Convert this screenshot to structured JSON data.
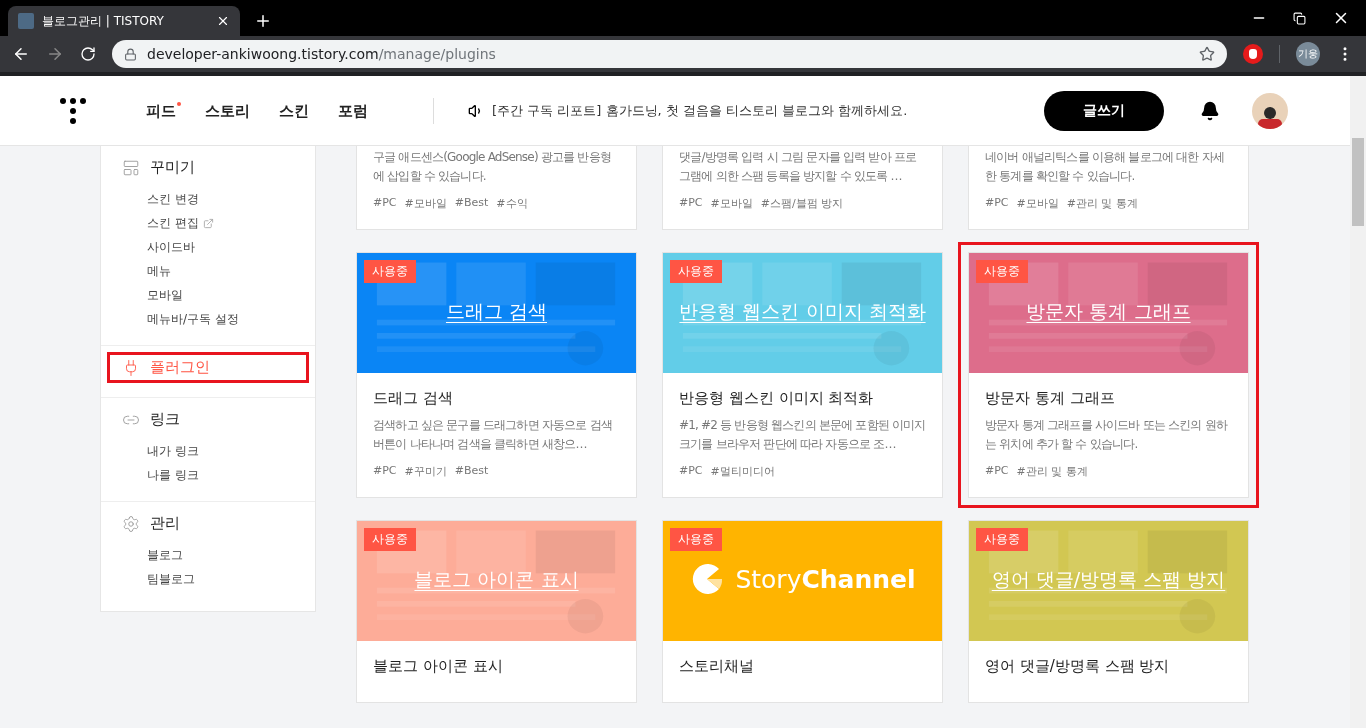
{
  "browser": {
    "tab": {
      "title": "블로그관리 | TISTORY"
    },
    "address": {
      "host": "developer-ankiwoong.tistory.com",
      "path": "/manage/plugins"
    },
    "profile": "기웅"
  },
  "header": {
    "nav": [
      {
        "label": "피드",
        "new": true
      },
      {
        "label": "스토리",
        "new": false
      },
      {
        "label": "스킨",
        "new": false
      },
      {
        "label": "포럼",
        "new": false
      }
    ],
    "notice": "[주간 구독 리포트] 홈가드닝, 첫 걸음을 티스토리 블로그와 함께하세요.",
    "write_button": "글쓰기"
  },
  "sidebar": [
    {
      "label": "꾸미기",
      "selected": false,
      "highlighted": false,
      "items": [
        {
          "label": "스킨 변경",
          "external": false
        },
        {
          "label": "스킨 편집",
          "external": true
        },
        {
          "label": "사이드바",
          "external": false
        },
        {
          "label": "메뉴",
          "external": false
        },
        {
          "label": "모바일",
          "external": false
        },
        {
          "label": "메뉴바/구독 설정",
          "external": false
        }
      ]
    },
    {
      "label": "플러그인",
      "selected": true,
      "highlighted": true
    },
    {
      "label": "링크",
      "selected": false,
      "highlighted": false,
      "items": [
        {
          "label": "내가 링크",
          "external": false
        },
        {
          "label": "나를 링크",
          "external": false
        }
      ]
    },
    {
      "label": "관리",
      "selected": false,
      "highlighted": false,
      "items": [
        {
          "label": "블로그",
          "external": false
        },
        {
          "label": "팀블로그",
          "external": false
        }
      ]
    }
  ],
  "plugins": [
    {
      "description": "구글 애드센스(Google AdSense) 광고를 반응형에 삽입할 수 있습니다.",
      "tags": [
        "#PC",
        "#모바일",
        "#Best",
        "#수익"
      ],
      "highlighted": false
    },
    {
      "description": "댓글/방명록 입력 시 그림 문자를 입력 받아 프로그램에 의한 스팸 등록을 방지할 수 있도록 …",
      "tags": [
        "#PC",
        "#모바일",
        "#스팸/블펌 방지"
      ],
      "highlighted": false
    },
    {
      "description": "네이버 애널리틱스를 이용해 블로그에 대한 자세한 통계를 확인할 수 있습니다.",
      "tags": [
        "#PC",
        "#모바일",
        "#관리 및 통계"
      ],
      "highlighted": false
    },
    {
      "image": {
        "kind": "picture",
        "color": "#0a85f5",
        "title": "드래그 검색"
      },
      "badge": "사용중",
      "title": "드래그 검색",
      "description": "검색하고 싶은 문구를 드래그하면 자동으로 검색 버튼이 나타나며 검색을 클릭하면 새창으…",
      "tags": [
        "#PC",
        "#꾸미기",
        "#Best"
      ],
      "highlighted": false
    },
    {
      "image": {
        "kind": "picture",
        "color": "#62cde8",
        "title": "반응형 웹스킨 이미지 최적화"
      },
      "badge": "사용중",
      "title": "반응형 웹스킨 이미지 최적화",
      "description": "#1, #2 등 반응형 웹스킨의 본문에 포함된 이미지 크기를 브라우저 판단에 따라 자동으로 조…",
      "tags": [
        "#PC",
        "#멀티미디어"
      ],
      "highlighted": false
    },
    {
      "image": {
        "kind": "picture",
        "color": "#dd6d8b",
        "title": "방문자 통계 그래프"
      },
      "badge": "사용중",
      "title": "방문자 통계 그래프",
      "description": "방문자 통계 그래프를 사이드바 또는 스킨의 원하는 위치에 추가 할 수 있습니다.",
      "tags": [
        "#PC",
        "#관리 및 통계"
      ],
      "highlighted": true
    },
    {
      "image": {
        "kind": "picture",
        "color": "#fdac98",
        "title": "블로그 아이콘 표시"
      },
      "badge": "사용중",
      "title": "블로그 아이콘 표시",
      "highlighted": false
    },
    {
      "image": {
        "kind": "logo",
        "color": "#ffb400",
        "title": "Story",
        "title_bold": "Channel"
      },
      "badge": "사용중",
      "title": "스토리채널",
      "highlighted": false
    },
    {
      "image": {
        "kind": "picture",
        "color": "#d2c752",
        "title": "영어 댓글/방명록 스팸 방지"
      },
      "badge": "사용중",
      "title": "영어 댓글/방명록 스팸 방지",
      "highlighted": false
    }
  ]
}
